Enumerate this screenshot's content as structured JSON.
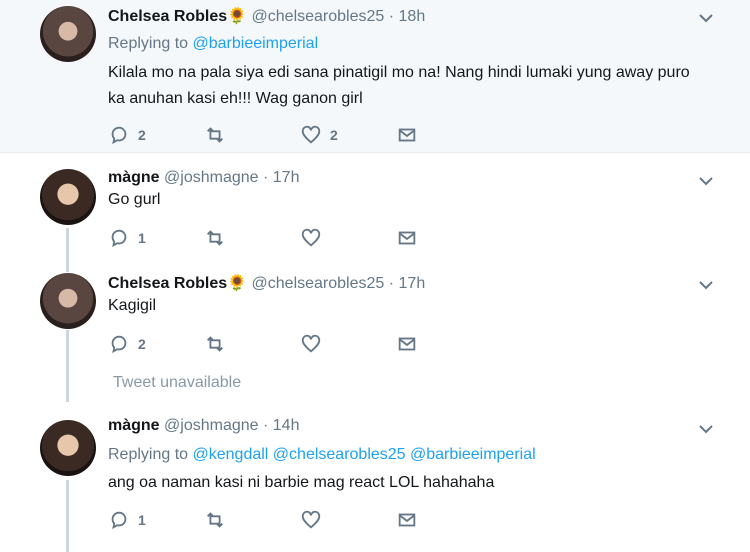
{
  "tweets": [
    {
      "name": "Chelsea Robles",
      "emoji": "🌻",
      "handle": "@chelsearobles25",
      "time": "18h",
      "replying_prefix": "Replying to",
      "replying_to": [
        "@barbieeimperial"
      ],
      "text_lines": [
        "Kilala mo na pala siya edi sana pinatigil mo na! Nang hindi lumaki yung away puro",
        "ka anuhan kasi eh!!!  Wag ganon girl"
      ],
      "replies": "2",
      "retweets": "",
      "likes": "2"
    },
    {
      "name": "màgne",
      "handle": "@joshmagne",
      "time": "17h",
      "text_lines": [
        "Go gurl"
      ],
      "replies": "1",
      "retweets": "",
      "likes": ""
    },
    {
      "name": "Chelsea Robles",
      "emoji": "🌻",
      "handle": "@chelsearobles25",
      "time": "17h",
      "text_lines": [
        "Kagigil"
      ],
      "replies": "2",
      "retweets": "",
      "likes": ""
    },
    {
      "name": "màgne",
      "handle": "@joshmagne",
      "time": "14h",
      "replying_prefix": "Replying to",
      "replying_to": [
        "@kengdall",
        "@chelsearobles25",
        "@barbieeimperial"
      ],
      "text_lines": [
        "ang oa naman kasi ni barbie mag react LOL hahahaha"
      ],
      "replies": "1",
      "retweets": "",
      "likes": ""
    }
  ],
  "unavailable_text": "Tweet unavailable",
  "icons": [
    "reply-icon",
    "retweet-icon",
    "like-icon",
    "dm-icon",
    "chevron-down-icon"
  ],
  "colors": {
    "link": "#1da1f2",
    "muted": "#657786",
    "highlight_bg": "#f5f8fa"
  }
}
